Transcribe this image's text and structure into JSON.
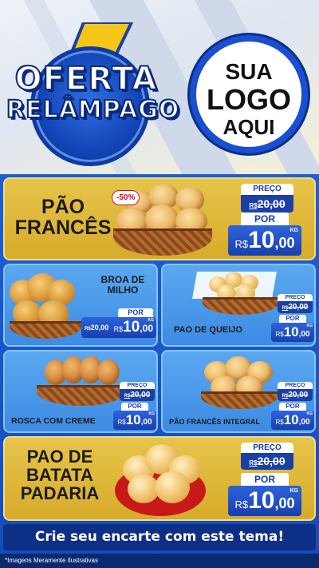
{
  "header": {
    "offer_line1": "OFERTA",
    "offer_line2": "RELÂMPAGO",
    "logo_line1": "SUA",
    "logo_line2": "LOGO",
    "logo_line3": "AQUI"
  },
  "products": [
    {
      "title_lines": [
        "PÃO",
        "FRANCÊS"
      ],
      "discount": "-50%",
      "preco_label": "PREÇO",
      "old_currency": "R$",
      "old_price": "20,00",
      "por_label": "POR",
      "currency": "R$",
      "price_int": "10",
      "price_dec": ",00",
      "unit": "KG"
    },
    {
      "title_lines": [
        "BROA DE",
        "MILHO"
      ],
      "preco_label": "",
      "old_currency": "R$",
      "old_price": "20,00",
      "por_label": "POR",
      "currency": "R$",
      "price_int": "10",
      "price_dec": ",00",
      "unit": "KG"
    },
    {
      "title_lines": [
        "PAO DE QUEIJO"
      ],
      "preco_label": "PREÇO",
      "old_currency": "R$",
      "old_price": "20,00",
      "por_label": "POR",
      "currency": "R$",
      "price_int": "10",
      "price_dec": ",00",
      "unit": "KG"
    },
    {
      "title_lines": [
        "ROSCA COM CREME"
      ],
      "preco_label": "PREÇO",
      "old_currency": "R$",
      "old_price": "20,00",
      "por_label": "POR",
      "currency": "R$",
      "price_int": "10",
      "price_dec": ",00",
      "unit": "KG"
    },
    {
      "title_lines": [
        "PÃO FRANCÊS INTEGRAL"
      ],
      "preco_label": "PREÇO",
      "old_currency": "R$",
      "old_price": "20,00",
      "por_label": "POR",
      "currency": "R$",
      "price_int": "10",
      "price_dec": ",00",
      "unit": "KG"
    },
    {
      "title_lines": [
        "PAO DE",
        "BATATA",
        "PADARIA"
      ],
      "preco_label": "PREÇO",
      "old_currency": "R$",
      "old_price": "20,00",
      "por_label": "POR",
      "currency": "R$",
      "price_int": "10",
      "price_dec": ",00",
      "unit": "KG"
    }
  ],
  "cta": "Crie seu encarte com este tema!",
  "footer": "*Imagens Meramente Ilustrativas",
  "colors": {
    "gold_card": "#dcb336",
    "blue_card": "#4a98ea",
    "price_blue": "#1a3fa6",
    "background_blue": "#1a56c8",
    "discount_red": "#c8102e"
  },
  "icons": {
    "offer_emblem": "lightning-bolt-icon"
  }
}
